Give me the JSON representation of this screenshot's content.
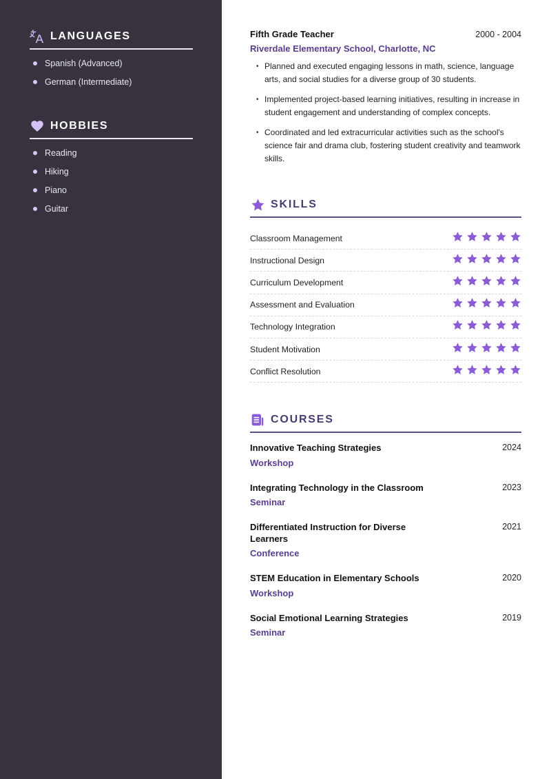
{
  "sidebar": {
    "languages": {
      "icon": "translate-icon",
      "title": "LANGUAGES",
      "items": [
        "Spanish (Advanced)",
        "German (Intermediate)"
      ]
    },
    "hobbies": {
      "icon": "heart-icon",
      "title": "HOBBIES",
      "items": [
        "Reading",
        "Hiking",
        "Piano",
        "Guitar"
      ]
    }
  },
  "experience": {
    "title": "Fifth Grade Teacher",
    "date": "2000 - 2004",
    "organization": "Riverdale Elementary School, Charlotte, NC",
    "bullets": [
      "Planned and executed engaging lessons in math, science, language arts, and social studies for a diverse group of 30 students.",
      "Implemented project-based learning initiatives, resulting in increase in student engagement and understanding of complex concepts.",
      "Coordinated and led extracurricular activities such as the school's science fair and drama club, fostering student creativity and teamwork skills."
    ]
  },
  "skills": {
    "icon": "star-icon",
    "title": "SKILLS",
    "max_rating": 5,
    "items": [
      {
        "name": "Classroom Management",
        "rating": 5
      },
      {
        "name": "Instructional Design",
        "rating": 5
      },
      {
        "name": "Curriculum Development",
        "rating": 5
      },
      {
        "name": "Assessment and Evaluation",
        "rating": 5
      },
      {
        "name": "Technology Integration",
        "rating": 5
      },
      {
        "name": "Student Motivation",
        "rating": 5
      },
      {
        "name": "Conflict Resolution",
        "rating": 5
      }
    ]
  },
  "courses": {
    "icon": "document-icon",
    "title": "COURSES",
    "items": [
      {
        "title": "Innovative Teaching Strategies",
        "type": "Workshop",
        "year": "2024"
      },
      {
        "title": "Integrating Technology in the Classroom",
        "type": "Seminar",
        "year": "2023"
      },
      {
        "title": "Differentiated Instruction for Diverse Learners",
        "type": "Conference",
        "year": "2021"
      },
      {
        "title": "STEM Education in Elementary Schools",
        "type": "Workshop",
        "year": "2020"
      },
      {
        "title": "Social Emotional Learning Strategies",
        "type": "Seminar",
        "year": "2019"
      }
    ]
  },
  "colors": {
    "sidebar_bg": "#37323e",
    "accent": "#8a5cd6",
    "heading": "#4a3a72",
    "subtitle": "#5a3e8c"
  }
}
